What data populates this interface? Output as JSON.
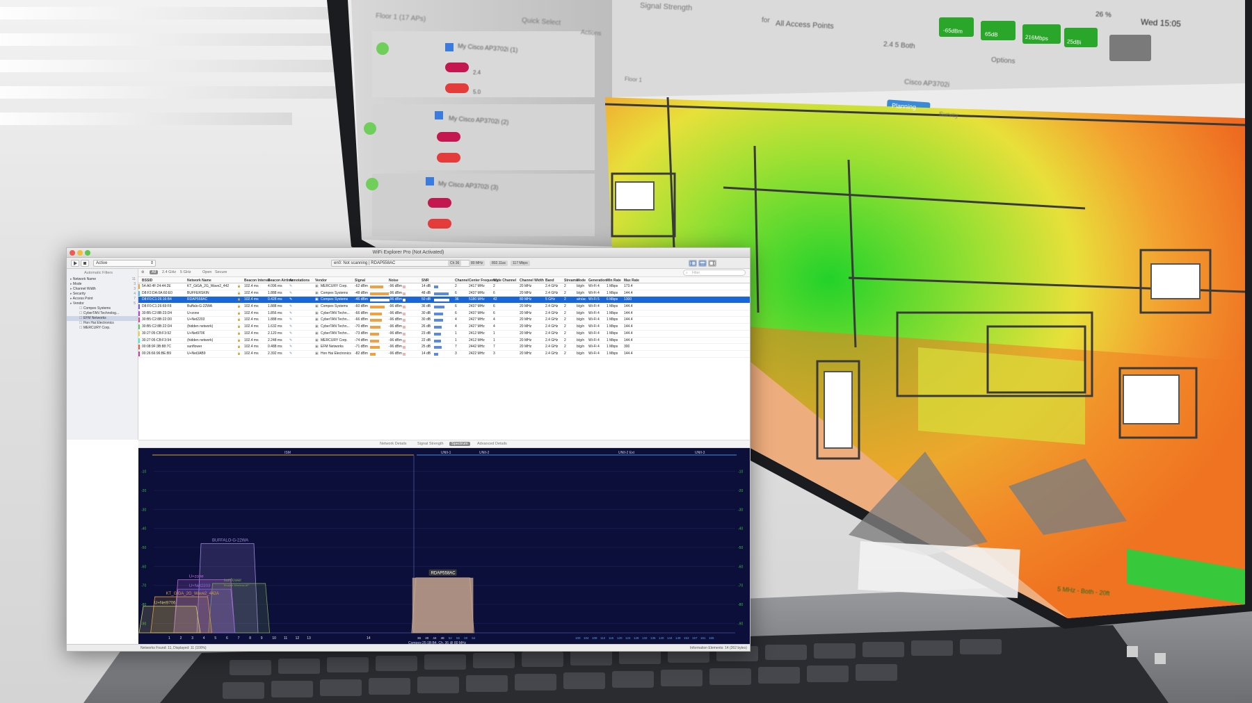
{
  "window": {
    "title": "WiFi Explorer Pro (Not Activated)",
    "mode_select": "Active",
    "scan_status": "en0: Not scanning",
    "selected_network": "RDAP558AC",
    "status_left": "Networks Found: 11, Displayed: 11 (100%)",
    "status_right": "Information Elements: 14 (262 bytes)",
    "search_placeholder": "Filter"
  },
  "toolbar": {
    "chips": [
      "Ch 36",
      "80 MHz",
      "802.11ac",
      "117 Mbps"
    ]
  },
  "filterbar": {
    "items": [
      "All",
      "2.4 GHz",
      "5 GHz",
      "Open",
      "Secure"
    ]
  },
  "sidebar": {
    "heading": "Automatic Filters",
    "items": [
      {
        "label": "Network Name",
        "count": "11"
      },
      {
        "label": "Mode",
        "count": "3"
      },
      {
        "label": "Channel Width",
        "count": "3"
      },
      {
        "label": "Security",
        "count": "4"
      },
      {
        "label": "Access Point",
        "count": "7"
      },
      {
        "label": "Vendor",
        "count": "5"
      },
      {
        "label": "Compex Systems",
        "count": ""
      },
      {
        "label": "CyberTAN Technolog...",
        "count": ""
      },
      {
        "label": "EFM Networks",
        "count": ""
      },
      {
        "label": "Hon Hai Electronics",
        "count": ""
      },
      {
        "label": "MERCURY Corp.",
        "count": ""
      }
    ]
  },
  "table": {
    "columns": [
      "BSSID",
      "Network Name",
      "Beacon Interval",
      "Beacon Airtime",
      "Annotations",
      "Vendor",
      "Signal",
      "Noise",
      "SNR",
      "Channel",
      "Center Frequency",
      "Wide Channel",
      "Channel Width",
      "Band",
      "Streams",
      "Mode",
      "Generation",
      "Min Rate",
      "Max Rate"
    ],
    "rows": [
      [
        "54:A0:4F:24:44:2E",
        "KT_GiGA_2G_Wave2_442A",
        "102.4 ms",
        "4.096 ms",
        "",
        "MERCURY Corp.",
        "-62 dBm",
        "-96 dBm",
        "14 dB",
        "2",
        "2417 MHz",
        "2",
        "20 MHz",
        "2.4 GHz",
        "2",
        "b/g/n",
        "Wi-Fi 4",
        "1 Mbps",
        "173.4"
      ],
      [
        "D8:F2:DA:0A:60:E0",
        "BUFFERSKIN",
        "102.4 ms",
        "1.888 ms",
        "",
        "Compex Systems",
        "-48 dBm",
        "-96 dBm",
        "48 dB",
        "6",
        "2437 MHz",
        "6",
        "20 MHz",
        "2.4 GHz",
        "2",
        "b/g/n",
        "Wi-Fi 4",
        "1 Mbps",
        "144.4"
      ],
      [
        "D8:F0:C1:26:16:B4",
        "RDAP558AC",
        "102.4 ms",
        "0.428 ms",
        "",
        "Compex Systems",
        "-46 dBm",
        "-96 dBm",
        "50 dB",
        "36",
        "5180 MHz",
        "42",
        "80 MHz",
        "5 GHz",
        "2",
        "a/n/ac",
        "Wi-Fi 5",
        "6 Mbps",
        "1300"
      ],
      [
        "D8:F0:C1:26:69:F8",
        "Buffalo-G-22WA",
        "102.4 ms",
        "1.888 ms",
        "",
        "Compex Systems",
        "-60 dBm",
        "-96 dBm",
        "36 dB",
        "6",
        "2437 MHz",
        "6",
        "20 MHz",
        "2.4 GHz",
        "2",
        "b/g/n",
        "Wi-Fi 4",
        "1 Mbps",
        "144.4"
      ],
      [
        "30:B5:C2:8B:23:D4",
        "U+zone",
        "102.4 ms",
        "1.856 ms",
        "",
        "CyberTAN Techn...",
        "-66 dBm",
        "-96 dBm",
        "30 dB",
        "6",
        "2437 MHz",
        "6",
        "20 MHz",
        "2.4 GHz",
        "2",
        "b/g/n",
        "Wi-Fi 4",
        "1 Mbps",
        "144.4"
      ],
      [
        "30:B5:C2:8B:22:D0",
        "U+Net2203",
        "102.4 ms",
        "1.888 ms",
        "",
        "CyberTAN Techn...",
        "-66 dBm",
        "-96 dBm",
        "30 dB",
        "4",
        "2427 MHz",
        "4",
        "20 MHz",
        "2.4 GHz",
        "2",
        "b/g/n",
        "Wi-Fi 4",
        "1 Mbps",
        "144.4"
      ],
      [
        "30:B5:C2:8B:22:D4",
        "(hidden network)",
        "102.4 ms",
        "1.632 ms",
        "",
        "CyberTAN Techn...",
        "-70 dBm",
        "-96 dBm",
        "26 dB",
        "4",
        "2427 MHz",
        "4",
        "20 MHz",
        "2.4 GHz",
        "2",
        "b/g/n",
        "Wi-Fi 4",
        "1 Mbps",
        "144.4"
      ],
      [
        "30:27:05:CB:F3:92",
        "U+Net9706",
        "102.4 ms",
        "2.120 ms",
        "",
        "CyberTAN Techn...",
        "-73 dBm",
        "-96 dBm",
        "23 dB",
        "1",
        "2412 MHz",
        "1",
        "20 MHz",
        "2.4 GHz",
        "2",
        "b/g/n",
        "Wi-Fi 4",
        "1 Mbps",
        "144.4"
      ],
      [
        "30:27:05:CB:F3:94",
        "(hidden network)",
        "102.4 ms",
        "2.248 ms",
        "",
        "MERCURY Corp.",
        "-74 dBm",
        "-96 dBm",
        "22 dB",
        "1",
        "2412 MHz",
        "1",
        "20 MHz",
        "2.4 GHz",
        "2",
        "b/g/n",
        "Wi-Fi 4",
        "1 Mbps",
        "144.4"
      ],
      [
        "00:08:9F:3B:88:7C",
        "sunflower",
        "102.4 ms",
        "0.488 ms",
        "",
        "EFM Networks",
        "-71 dBm",
        "-96 dBm",
        "25 dB",
        "7",
        "2442 MHz",
        "7",
        "20 MHz",
        "2.4 GHz",
        "2",
        "b/g/n",
        "Wi-Fi 4",
        "1 Mbps",
        "300"
      ],
      [
        "00:26:66:96:BE:B9",
        "U+Net3AB9",
        "102.4 ms",
        "2.392 ms",
        "",
        "Hon Hai Electronics",
        "-82 dBm",
        "-96 dBm",
        "14 dB",
        "3",
        "2422 MHz",
        "3",
        "20 MHz",
        "2.4 GHz",
        "2",
        "b/g/n",
        "Wi-Fi 4",
        "1 Mbps",
        "144.4"
      ]
    ],
    "row_colors": [
      "#f2a73b",
      "#3bc2f2",
      "#1a66d8",
      "#7a5af2",
      "#c23bf2",
      "#f23b8e",
      "#5ad05a",
      "#f2d23b",
      "#3bf2c2",
      "#f25a3b",
      "#d23b9e"
    ],
    "signal_pct": [
      0.52,
      0.75,
      0.78,
      0.58,
      0.48,
      0.48,
      0.42,
      0.37,
      0.35,
      0.4,
      0.22
    ],
    "snr_pct": [
      0.22,
      0.74,
      0.77,
      0.55,
      0.46,
      0.46,
      0.4,
      0.35,
      0.34,
      0.38,
      0.22
    ]
  },
  "detail_tabs": {
    "items": [
      "Network Details",
      "Signal Strength",
      "Spectrum",
      "Advanced Details"
    ],
    "active": "Spectrum"
  },
  "chart_data": {
    "type": "area",
    "title": "",
    "bands": [
      "ISM",
      "UNII-1",
      "UNII-2",
      "UNII-2 Ext",
      "UNII-3"
    ],
    "y_ticks": [
      -10,
      -20,
      -30,
      -40,
      -50,
      -60,
      -70,
      -80,
      -90
    ],
    "ylim": [
      -95,
      -5
    ],
    "x_ticks_24": [
      1,
      2,
      3,
      4,
      5,
      6,
      7,
      8,
      9,
      10,
      11,
      12,
      13,
      14
    ],
    "x_ticks_5": [
      36,
      40,
      44,
      48,
      52,
      56,
      60,
      64
    ],
    "x_ticks_5_high": [
      100,
      104,
      108,
      112,
      116,
      120,
      124,
      128,
      132,
      136,
      140,
      144,
      149,
      153,
      157,
      161,
      165
    ],
    "footer": "Compex:25:1B:B4, Ch. 36 @ 80 MHz",
    "series": [
      {
        "name": "BUFFALO-G-22WA",
        "channel": 6,
        "width": 20,
        "signal": -48,
        "color": "#9e8ad8"
      },
      {
        "name": "U+zone",
        "channel": 4,
        "width": 20,
        "signal": -67,
        "color": "#c06ad8"
      },
      {
        "name": "sunflower",
        "channel": 7,
        "width": 20,
        "signal": -69,
        "color": "#7aa050",
        "sub": "Realtek Wireless AP"
      },
      {
        "name": "U+Net2203",
        "channel": 4,
        "width": 20,
        "signal": -72,
        "color": "#8a6ad8"
      },
      {
        "name": "KT_GiGA_2G_Wave2_442A",
        "channel": 2,
        "width": 20,
        "signal": -76,
        "color": "#d89a3a"
      },
      {
        "name": "U+Net9706",
        "channel": 1,
        "width": 20,
        "signal": -81,
        "color": "#d8d06a"
      },
      {
        "name": "RDAP558AC",
        "channel": 36,
        "width": 80,
        "signal": -66,
        "color": "#c9a890"
      }
    ]
  },
  "background_app": {
    "panel_title": "Signal Strength",
    "for_label": "for",
    "for_value": "All Access Points",
    "floor": "Floor 1 (17 APs)",
    "quick_select": "Quick Select",
    "actions": "Actions",
    "ap_items": [
      "My  Cisco AP3702i (1)",
      "My  Cisco AP3702i (2)",
      "My  Cisco AP3702i (3)"
    ],
    "bands": [
      "2.4",
      "5.0"
    ],
    "planning_tab": "Planning",
    "survey_tab": "Survey",
    "ap_model": "Cisco AP3702i",
    "metrics": [
      "-65dBm",
      "65dB",
      "216Mbps",
      "25dBi"
    ],
    "menu_clock": "Wed 15:05",
    "menu_battery": "26 %",
    "scale_caption": "2.4  5  Both",
    "options": "Options",
    "floor_selector": "Floor 1",
    "bottom_note": "5 MHz - Both - 20ft"
  }
}
